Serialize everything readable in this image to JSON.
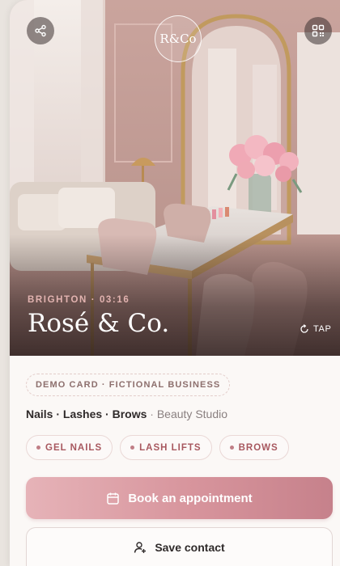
{
  "business": {
    "monogram": "R&Co",
    "location": "BRIGHTON · 03:16",
    "name": "Rosé & Co.",
    "tap_hint": "TAP",
    "demo_tag": "DEMO CARD · FICTIONAL BUSINESS",
    "services_main": "Nails · Lashes · Brows",
    "services_sep": " · ",
    "services_type": "Beauty Studio"
  },
  "chips": [
    "GEL NAILS",
    "LASH LIFTS",
    "BROWS"
  ],
  "actions": {
    "book_label": "Book an appointment",
    "save_label": "Save contact"
  },
  "icons": {
    "share": "share-icon",
    "qr": "qr-code-icon",
    "tap": "rotate-icon",
    "calendar": "calendar-icon",
    "save": "add-person-icon"
  },
  "colors": {
    "accent": "#d7949c",
    "chip_text": "#a8585f",
    "location_text": "#e2b3b0"
  }
}
